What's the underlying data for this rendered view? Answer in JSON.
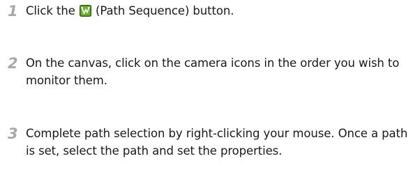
{
  "steps": [
    {
      "number": "1",
      "text_before_icon": "Click the ",
      "icon": "path-sequence-icon",
      "text_after_icon": " (Path Sequence) button."
    },
    {
      "number": "2",
      "text": "On the canvas, click on the camera icons in the order you wish to monitor them."
    },
    {
      "number": "3",
      "text": "Complete path selection by right-clicking your mouse. Once a path is set, select the path and set the properties."
    }
  ],
  "colors": {
    "step_number": "#a8a8a8",
    "text": "#1a1a1a",
    "icon_bg": "#4c8a1c",
    "icon_border": "#2f5e0c"
  }
}
